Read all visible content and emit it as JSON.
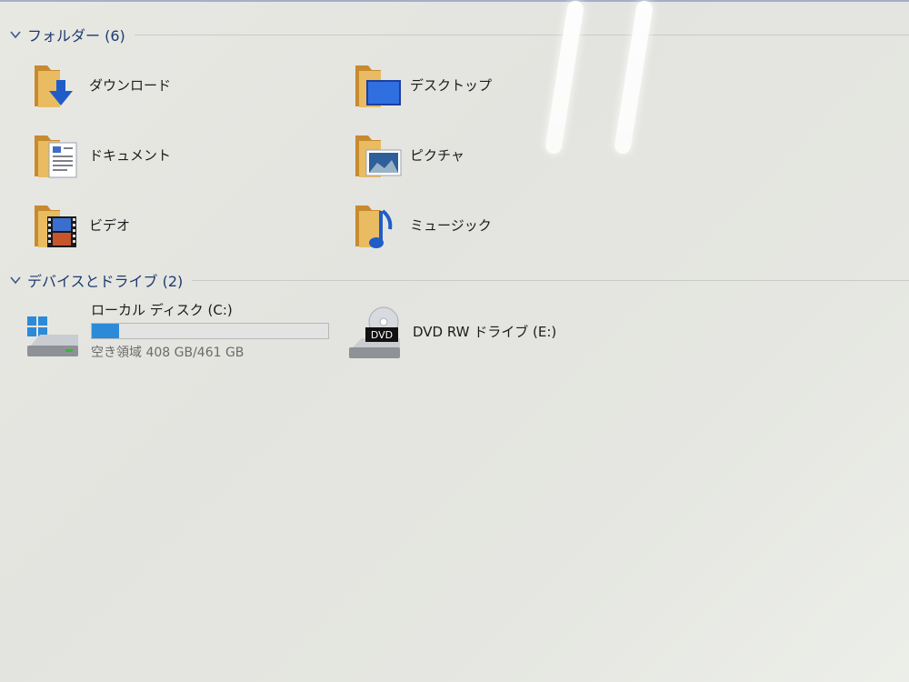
{
  "sections": {
    "folders": {
      "title": "フォルダー (6)"
    },
    "devices": {
      "title": "デバイスとドライブ (2)"
    }
  },
  "folders": [
    {
      "label": "ダウンロード",
      "icon": "downloads-folder-icon"
    },
    {
      "label": "デスクトップ",
      "icon": "desktop-folder-icon"
    },
    {
      "label": "ドキュメント",
      "icon": "documents-folder-icon"
    },
    {
      "label": "ピクチャ",
      "icon": "pictures-folder-icon"
    },
    {
      "label": "ビデオ",
      "icon": "videos-folder-icon"
    },
    {
      "label": "ミュージック",
      "icon": "music-folder-icon"
    }
  ],
  "drives": [
    {
      "name": "ローカル ディスク (C:)",
      "free_text": "空き領域 408 GB/461 GB",
      "used_fraction": 0.115,
      "icon": "windows-drive-icon"
    },
    {
      "name": "DVD RW ドライブ (E:)",
      "icon": "dvd-drive-icon",
      "badge": "DVD"
    }
  ],
  "colors": {
    "accent": "#2d8ad8",
    "header_text": "#1e3a6e",
    "folder": "#e3b35c"
  }
}
